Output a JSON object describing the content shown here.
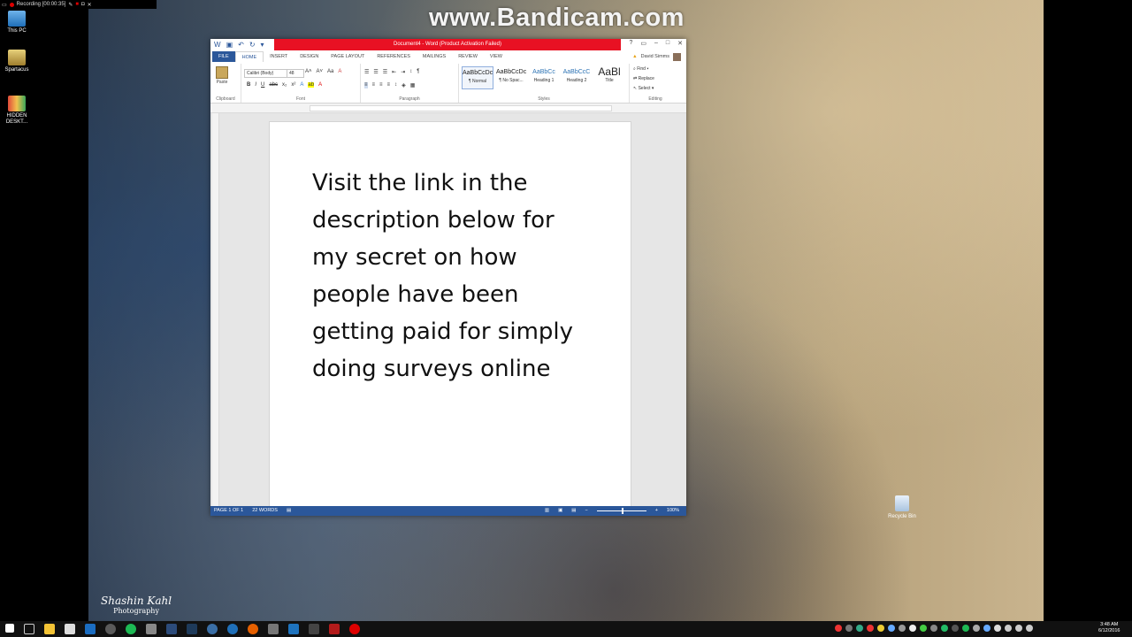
{
  "watermark": "www.Bandicam.com",
  "recorder": {
    "status": "Recording [00:00:35]"
  },
  "desktop": {
    "icons": [
      {
        "label": "This PC"
      },
      {
        "label": "Spartacus"
      },
      {
        "label": "HIDDEN DESKT..."
      }
    ],
    "recycle_bin": "Recycle Bin",
    "signature": {
      "name": "Shashin Kahl",
      "sub": "Photography"
    }
  },
  "word": {
    "title": "Document4 - Word (Product Activation Failed)",
    "tabs": [
      "FILE",
      "HOME",
      "INSERT",
      "DESIGN",
      "PAGE LAYOUT",
      "REFERENCES",
      "MAILINGS",
      "REVIEW",
      "VIEW"
    ],
    "active_tab": "HOME",
    "user": "David Simms",
    "ribbon": {
      "paste_label": "Paste",
      "font_name": "Calibri (Body)",
      "font_size": "48",
      "group_labels": [
        "Clipboard",
        "Font",
        "Paragraph",
        "Styles",
        "Editing"
      ],
      "styles": [
        {
          "sample": "AaBbCcDc",
          "name": "¶ Normal"
        },
        {
          "sample": "AaBbCcDc",
          "name": "¶ No Spac..."
        },
        {
          "sample": "AaBbCc",
          "name": "Heading 1"
        },
        {
          "sample": "AaBbCcC",
          "name": "Heading 2"
        },
        {
          "sample": "AaBl",
          "name": "Title"
        }
      ],
      "editing": [
        "Find ▾",
        "Replace",
        "Select ▾"
      ]
    },
    "document_text": "Visit the link in the description below for my secret on how people have been getting paid for simply doing surveys online",
    "status": {
      "page": "PAGE 1 OF 1",
      "words": "22 WORDS",
      "zoom": "100%"
    }
  },
  "clock": {
    "time": "3:48 AM",
    "date": "6/12/2016"
  },
  "colors": {
    "word_blue": "#2b579a",
    "title_red": "#e81123"
  }
}
